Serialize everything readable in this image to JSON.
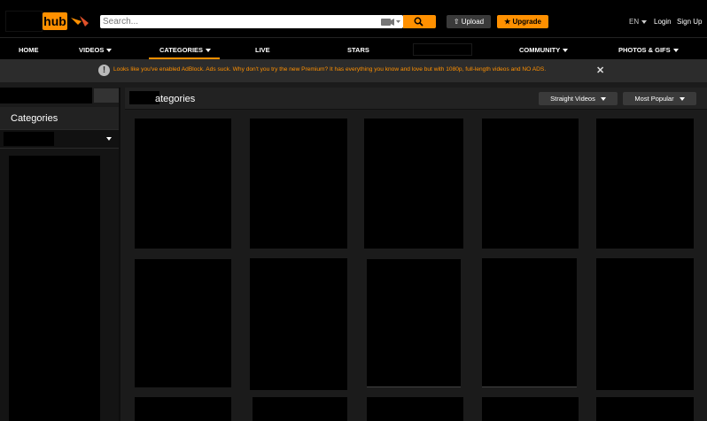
{
  "header": {
    "logo_text": "hub",
    "search_placeholder": "Search...",
    "upload_label": "Upload",
    "upgrade_label": "Upgrade",
    "language": "EN",
    "login_label": "Login",
    "signup_label": "Sign Up",
    "brand_color": "#ff9000"
  },
  "nav": {
    "home": "HOME",
    "videos": "VIDEOS",
    "categories": "CATEGORIES",
    "live": "LIVE",
    "stars": "STARS",
    "community": "COMMUNITY",
    "photos": "PHOTOS & GIFS"
  },
  "notice": {
    "icon": "!",
    "text": "Looks like you've enabled AdBlock. Ads suck. Why don't you try the new Premium? It has everything you know and love but with 1080p, full-length videos and NO ADS.",
    "close": "✕"
  },
  "sidebar": {
    "title": "Categories"
  },
  "main": {
    "title": "ategories",
    "filter_orientation": "Straight Videos",
    "sort": "Most Popular"
  }
}
